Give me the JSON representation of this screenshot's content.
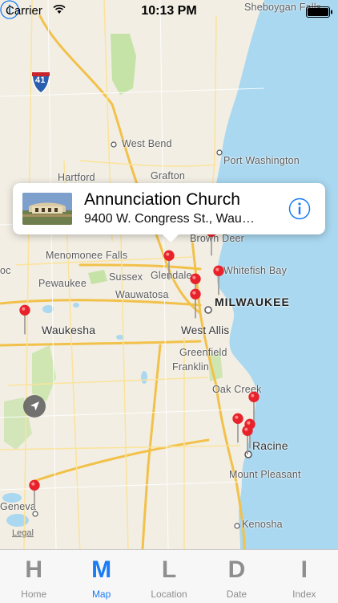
{
  "status_bar": {
    "carrier": "Carrier",
    "time": "10:13 PM"
  },
  "callout": {
    "title": "Annunciation Church",
    "subtitle": "9400 W. Congress St., Wau…",
    "info_icon": "info-icon"
  },
  "map": {
    "labels": {
      "sheboygan_falls": "Sheboygan Falls",
      "interstate": "41",
      "west_bend": "West Bend",
      "port_washington": "Port Washington",
      "hartford": "Hartford",
      "grafton": "Grafton",
      "brown_deer": "Brown Deer",
      "menomonee_falls": "Menomonee Falls",
      "whitefish_bay": "Whitefish Bay",
      "oc": "oc",
      "pewaukee": "Pewaukee",
      "sussex": "Sussex",
      "glendale": "Glendale",
      "wauwatosa": "Wauwatosa",
      "milwaukee": "MILWAUKEE",
      "waukesha": "Waukesha",
      "west_allis": "West Allis",
      "greenfield": "Greenfield",
      "franklin": "Franklin",
      "oak_creek": "Oak Creek",
      "racine": "Racine",
      "mount_pleasant": "Mount Pleasant",
      "geneva": "Geneva",
      "kenosha": "Kenosha"
    },
    "legal": "Legal"
  },
  "tabs": [
    {
      "glyph": "H",
      "label": "Home"
    },
    {
      "glyph": "M",
      "label": "Map"
    },
    {
      "glyph": "L",
      "label": "Location"
    },
    {
      "glyph": "D",
      "label": "Date"
    },
    {
      "glyph": "I",
      "label": "Index"
    }
  ],
  "active_tab": "Map",
  "colors": {
    "accent": "#1a7cf5",
    "pin": "#e8222b",
    "water": "#a9d8f0",
    "park": "#bfe0a0",
    "road": "#f6c94c"
  }
}
